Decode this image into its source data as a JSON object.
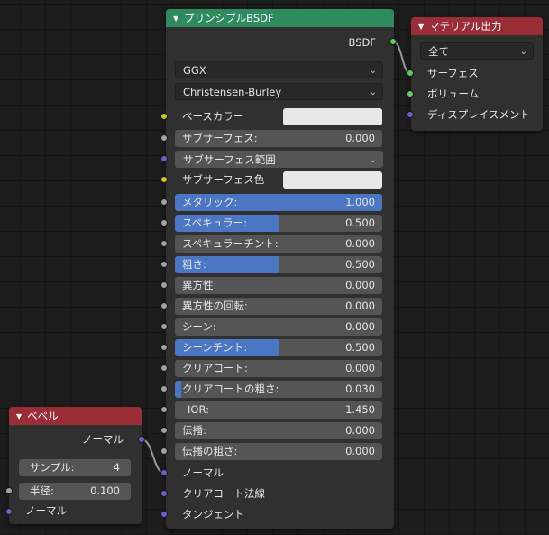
{
  "colors": {
    "shader_header": "#2e8a5f",
    "output_header": "#9a2d36",
    "slider_fill": "#4a76c4",
    "socket_float": "#a1a1a1",
    "socket_color": "#c7c729",
    "socket_vector": "#6363c7",
    "socket_shader": "#63c763"
  },
  "principled": {
    "title": "プリンシプルBSDF",
    "output_label": "BSDF",
    "distribution": "GGX",
    "subsurface_method": "Christensen-Burley",
    "base_color_label": "ベースカラー",
    "subsurface": {
      "label": "サブサーフェス:",
      "value": "0.000"
    },
    "subsurface_radius": "サブサーフェス範囲",
    "subsurface_color_label": "サブサーフェス色",
    "metallic": {
      "label": "メタリック:",
      "value": "1.000",
      "fraction": 1.0
    },
    "specular": {
      "label": "スペキュラー:",
      "value": "0.500",
      "fraction": 0.5
    },
    "specular_tint": {
      "label": "スペキュラーチント:",
      "value": "0.000"
    },
    "roughness": {
      "label": "粗さ:",
      "value": "0.500",
      "fraction": 0.5
    },
    "anisotropic": {
      "label": "異方性:",
      "value": "0.000"
    },
    "anisotropic_rotation": {
      "label": "異方性の回転:",
      "value": "0.000"
    },
    "sheen": {
      "label": "シーン:",
      "value": "0.000"
    },
    "sheen_tint": {
      "label": "シーンチント:",
      "value": "0.500",
      "fraction": 0.5
    },
    "clearcoat": {
      "label": "クリアコート:",
      "value": "0.000"
    },
    "clearcoat_roughness": {
      "label": "クリアコートの粗さ:",
      "value": "0.030",
      "fraction": 0.03
    },
    "ior": {
      "label": "IOR:",
      "value": "1.450"
    },
    "transmission": {
      "label": "伝播:",
      "value": "0.000"
    },
    "transmission_roughness": {
      "label": "伝播の粗さ:",
      "value": "0.000"
    },
    "normal_label": "ノーマル",
    "clearcoat_normal_label": "クリアコート法線",
    "tangent_label": "タンジェント"
  },
  "material_output": {
    "title": "マテリアル出力",
    "target": "全て",
    "surface_label": "サーフェス",
    "volume_label": "ボリューム",
    "displacement_label": "ディスプレイスメント"
  },
  "bevel": {
    "title": "ベベル",
    "output_label": "ノーマル",
    "samples": {
      "label": "サンプル:",
      "value": "4"
    },
    "radius": {
      "label": "半径:",
      "value": "0.100"
    },
    "normal_label": "ノーマル"
  }
}
